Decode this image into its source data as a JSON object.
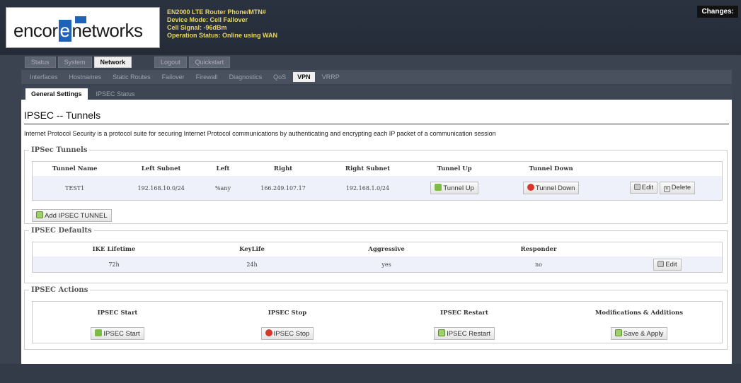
{
  "brand": {
    "logo_prefix": "encor",
    "logo_mark": "e",
    "logo_suffix": "networks"
  },
  "device_info": {
    "line1": "EN2000 LTE Router Phone/MTN#",
    "line2": "Device Mode: Cell Fallover",
    "line3": "Cell Signal: -96dBm",
    "line4": "Operation Status: Online using WAN"
  },
  "changes_label": "Changes:",
  "main_tabs": [
    "Status",
    "System",
    "Network",
    "Logout",
    "Quickstart"
  ],
  "sub_tabs": [
    "Interfaces",
    "Hostnames",
    "Static Routes",
    "Failover",
    "Firewall",
    "Diagnostics",
    "QoS",
    "VPN",
    "VRRP"
  ],
  "third_tabs": [
    "General Settings",
    "IPSEC Status"
  ],
  "page": {
    "title": "IPSEC -- Tunnels",
    "description": "Internet Protocol Security is a protocol suite for securing Internet Protocol communications by authenticating and encrypting each IP packet of a communication session"
  },
  "tunnels": {
    "legend": "IPSec Tunnels",
    "headers": [
      "Tunnel Name",
      "Left Subnet",
      "Left",
      "Right",
      "Right Subnet",
      "Tunnel Up",
      "Tunnel Down"
    ],
    "row": {
      "name": "TEST1",
      "left_subnet": "192.168.10.0/24",
      "left": "%any",
      "right": "166.249.107.17",
      "right_subnet": "192.168.1.0/24",
      "tunnel_up": "Tunnel Up",
      "tunnel_down": "Tunnel Down",
      "edit": "Edit",
      "delete": "Delete"
    },
    "add_button": "Add IPSEC TUNNEL"
  },
  "defaults": {
    "legend": "IPSEC Defaults",
    "headers": [
      "IKE Lifetime",
      "KeyLife",
      "Aggressive",
      "Responder"
    ],
    "row": {
      "ike_lifetime": "72h",
      "keylife": "24h",
      "aggressive": "yes",
      "responder": "no",
      "edit": "Edit"
    }
  },
  "actions": {
    "legend": "IPSEC Actions",
    "headers": [
      "IPSEC Start",
      "IPSEC Stop",
      "IPSEC Restart",
      "Modifications & Additions"
    ],
    "buttons": {
      "start": "IPSEC Start",
      "stop": "IPSEC Stop",
      "restart": "IPSEC Restart",
      "save": "Save & Apply"
    }
  }
}
